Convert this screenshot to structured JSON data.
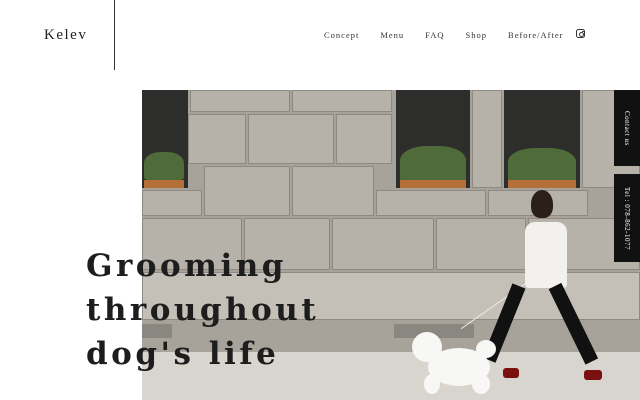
{
  "brand": {
    "logo": "Kelev"
  },
  "nav": {
    "items": [
      {
        "label": "Concept"
      },
      {
        "label": "Menu"
      },
      {
        "label": "FAQ"
      },
      {
        "label": "Shop"
      },
      {
        "label": "Before/After"
      }
    ],
    "social_icon": "instagram-icon"
  },
  "hero": {
    "headline_lines": [
      "Grooming",
      "throughout",
      "dog's life"
    ]
  },
  "side_tabs": {
    "contact": "Contact us",
    "tel": "Tel : 078-862-1077"
  },
  "colors": {
    "tab_bg": "#111111",
    "text": "#222222"
  }
}
